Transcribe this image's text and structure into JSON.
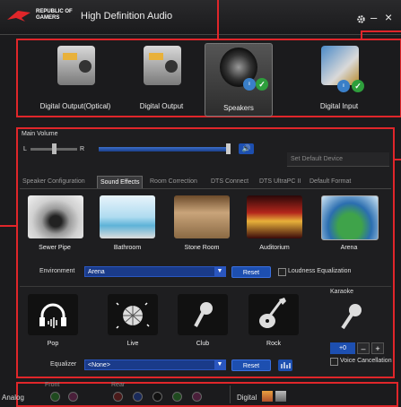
{
  "app": {
    "brand_line1": "REPUBLIC OF",
    "brand_line2": "GAMERS",
    "title": "High Definition Audio",
    "gear_icon": "gear-icon",
    "minimize_label": "–",
    "close_label": "×"
  },
  "devices": [
    {
      "label": "Digital Output(Optical)",
      "icon": "digital-output-optical-icon"
    },
    {
      "label": "Digital Output",
      "icon": "digital-output-icon"
    },
    {
      "label": "Speakers",
      "icon": "speakers-icon",
      "selected": true
    },
    {
      "label": "Digital Input",
      "icon": "digital-input-icon"
    }
  ],
  "volume": {
    "label": "Main Volume",
    "left_label": "L",
    "right_label": "R",
    "balance": 0.5,
    "level": 1.0,
    "set_default_device": "Set Default Device"
  },
  "tabs": [
    "Speaker Configuration",
    "Sound Effects",
    "Room Correction",
    "DTS Connect",
    "DTS UltraPC II",
    "Default Format"
  ],
  "active_tab": "Sound Effects",
  "environments": [
    {
      "label": "Sewer Pipe"
    },
    {
      "label": "Bathroom"
    },
    {
      "label": "Stone Room"
    },
    {
      "label": "Auditorium"
    },
    {
      "label": "Arena"
    }
  ],
  "environment": {
    "label": "Environment",
    "value": "Arena",
    "reset_label": "Reset",
    "loudness_label": "Loudness Equalization"
  },
  "equalizers": [
    {
      "label": "Pop"
    },
    {
      "label": "Live"
    },
    {
      "label": "Club"
    },
    {
      "label": "Rock"
    }
  ],
  "equalizer": {
    "label": "Equalizer",
    "value": "<None>",
    "reset_label": "Reset"
  },
  "karaoke": {
    "label": "Karaoke",
    "value": "+0",
    "minus_label": "–",
    "plus_label": "+",
    "voice_cancel_label": "Voice Cancellation"
  },
  "jacks": {
    "front_label": "Front",
    "rear_label": "Rear",
    "analog_label": "Analog",
    "digital_label": "Digital"
  },
  "colors": {
    "accent": "#e0262a",
    "blue": "#1d4fb0"
  }
}
